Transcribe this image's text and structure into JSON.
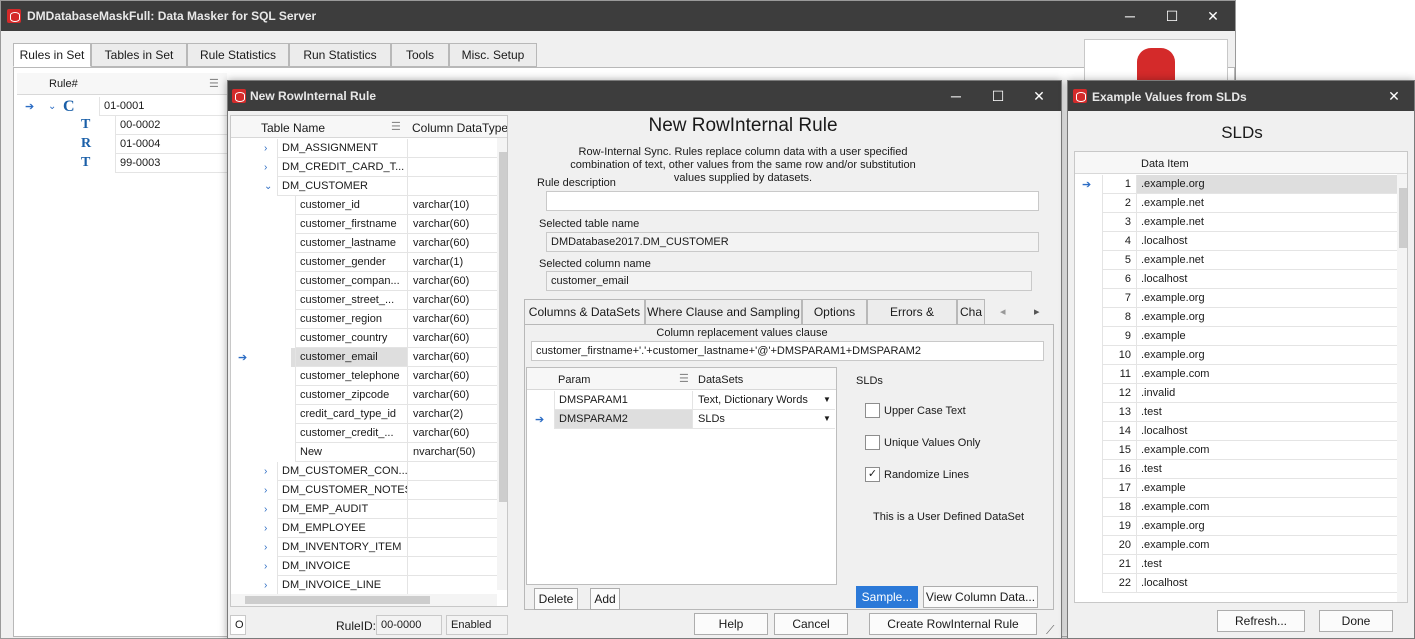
{
  "main_window": {
    "title": "DMDatabaseMaskFull: Data Masker for SQL Server",
    "tabs": [
      "Rules in Set",
      "Tables in Set",
      "Rule Statistics",
      "Run Statistics",
      "Tools",
      "Misc. Setup"
    ],
    "rules_header": "Rule#",
    "rules": [
      {
        "icon": "C",
        "id": "01-0001"
      },
      {
        "icon": "T",
        "id": "00-0002"
      },
      {
        "icon": "R",
        "id": "01-0004"
      },
      {
        "icon": "T",
        "id": "99-0003"
      }
    ]
  },
  "dialog": {
    "title": "New RowInternal Rule",
    "heading": "New RowInternal Rule",
    "description": "Row-Internal Sync. Rules replace column data with a user specified combination of text, other values from the same row and/or substitution values supplied by datasets.",
    "rule_description_label": "Rule description",
    "rule_description_value": "",
    "selected_table_label": "Selected table name",
    "selected_table_value": "DMDatabase2017.DM_CUSTOMER",
    "selected_column_label": "Selected column name",
    "selected_column_value": "customer_email",
    "table_grid": {
      "headers": [
        "Table Name",
        "Column DataType"
      ],
      "rows": [
        {
          "level": 0,
          "name": "DM_ASSIGNMENT",
          "type": "",
          "expanded": false
        },
        {
          "level": 0,
          "name": "DM_CREDIT_CARD_T...",
          "type": "",
          "expanded": false
        },
        {
          "level": 0,
          "name": "DM_CUSTOMER",
          "type": "",
          "expanded": true
        },
        {
          "level": 1,
          "name": "customer_id",
          "type": "varchar(10)"
        },
        {
          "level": 1,
          "name": "customer_firstname",
          "type": "varchar(60)"
        },
        {
          "level": 1,
          "name": "customer_lastname",
          "type": "varchar(60)"
        },
        {
          "level": 1,
          "name": "customer_gender",
          "type": "varchar(1)"
        },
        {
          "level": 1,
          "name": "customer_compan...",
          "type": "varchar(60)"
        },
        {
          "level": 1,
          "name": "customer_street_...",
          "type": "varchar(60)"
        },
        {
          "level": 1,
          "name": "customer_region",
          "type": "varchar(60)"
        },
        {
          "level": 1,
          "name": "customer_country",
          "type": "varchar(60)"
        },
        {
          "level": 1,
          "name": "customer_email",
          "type": "varchar(60)",
          "selected": true
        },
        {
          "level": 1,
          "name": "customer_telephone",
          "type": "varchar(60)"
        },
        {
          "level": 1,
          "name": "customer_zipcode",
          "type": "varchar(60)"
        },
        {
          "level": 1,
          "name": "credit_card_type_id",
          "type": "varchar(2)"
        },
        {
          "level": 1,
          "name": "customer_credit_...",
          "type": "varchar(60)"
        },
        {
          "level": 1,
          "name": "New",
          "type": "nvarchar(50)"
        },
        {
          "level": 0,
          "name": "DM_CUSTOMER_CON...",
          "type": "",
          "expanded": false
        },
        {
          "level": 0,
          "name": "DM_CUSTOMER_NOTES",
          "type": "",
          "expanded": false
        },
        {
          "level": 0,
          "name": "DM_EMP_AUDIT",
          "type": "",
          "expanded": false
        },
        {
          "level": 0,
          "name": "DM_EMPLOYEE",
          "type": "",
          "expanded": false
        },
        {
          "level": 0,
          "name": "DM_INVENTORY_ITEM",
          "type": "",
          "expanded": false
        },
        {
          "level": 0,
          "name": "DM_INVOICE",
          "type": "",
          "expanded": false
        },
        {
          "level": 0,
          "name": "DM_INVOICE_LINE",
          "type": "",
          "expanded": false
        }
      ]
    },
    "footer_left": {
      "o_label": "O",
      "ruleid_label": "RuleID:",
      "ruleid_value": "00-0000",
      "status": "Enabled"
    },
    "inner_tabs": [
      "Columns & DataSets",
      "Where Clause and Sampling",
      "Options",
      "Errors & Options",
      "Cha"
    ],
    "clause_label": "Column replacement values clause",
    "clause_value": "customer_firstname+'.'+customer_lastname+'@'+DMSPARAM1+DMSPARAM2",
    "param_grid": {
      "headers": [
        "Param",
        "DataSets"
      ],
      "rows": [
        {
          "param": "DMSPARAM1",
          "dataset": "Text, Dictionary Words"
        },
        {
          "param": "DMSPARAM2",
          "dataset": "SLDs"
        }
      ]
    },
    "dataset_panel": {
      "title": "SLDs",
      "options": [
        {
          "label": "Upper Case Text",
          "checked": false
        },
        {
          "label": "Unique Values Only",
          "checked": false
        },
        {
          "label": "Randomize Lines",
          "checked": true
        }
      ],
      "note": "This is a User Defined DataSet"
    },
    "buttons": {
      "delete": "Delete",
      "add": "Add",
      "sample": "Sample...",
      "view_column_data": "View Column Data...",
      "help": "Help",
      "cancel": "Cancel",
      "create": "Create RowInternal Rule"
    }
  },
  "examples_window": {
    "title": "Example Values from SLDs",
    "heading": "SLDs",
    "column_header": "Data Item",
    "rows": [
      {
        "n": "1",
        "v": ".example.org"
      },
      {
        "n": "2",
        "v": ".example.net"
      },
      {
        "n": "3",
        "v": ".example.net"
      },
      {
        "n": "4",
        "v": ".localhost"
      },
      {
        "n": "5",
        "v": ".example.net"
      },
      {
        "n": "6",
        "v": ".localhost"
      },
      {
        "n": "7",
        "v": ".example.org"
      },
      {
        "n": "8",
        "v": ".example.org"
      },
      {
        "n": "9",
        "v": ".example"
      },
      {
        "n": "10",
        "v": ".example.org"
      },
      {
        "n": "11",
        "v": ".example.com"
      },
      {
        "n": "12",
        "v": ".invalid"
      },
      {
        "n": "13",
        "v": ".test"
      },
      {
        "n": "14",
        "v": ".localhost"
      },
      {
        "n": "15",
        "v": ".example.com"
      },
      {
        "n": "16",
        "v": ".test"
      },
      {
        "n": "17",
        "v": ".example"
      },
      {
        "n": "18",
        "v": ".example.com"
      },
      {
        "n": "19",
        "v": ".example.org"
      },
      {
        "n": "20",
        "v": ".example.com"
      },
      {
        "n": "21",
        "v": ".test"
      },
      {
        "n": "22",
        "v": ".localhost"
      }
    ],
    "refresh": "Refresh...",
    "done": "Done"
  },
  "colors": {
    "titlebar": "#3d3d3d",
    "accent": "#2b79d8",
    "brand": "#d42a2a"
  }
}
